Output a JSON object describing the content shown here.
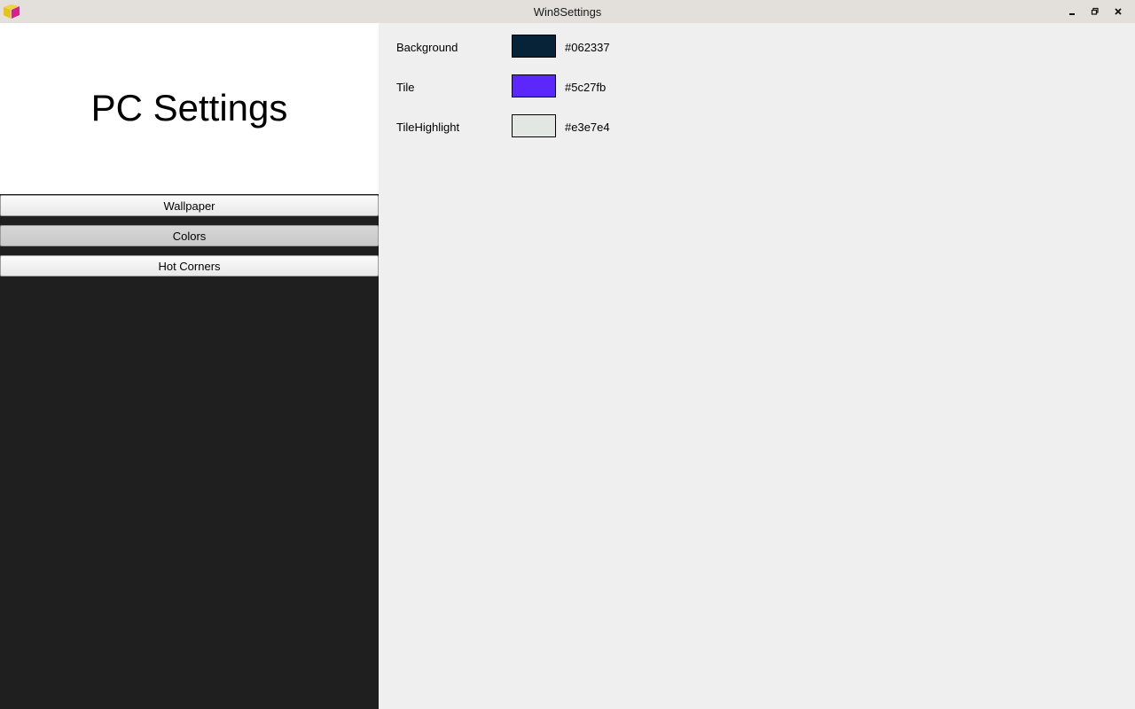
{
  "window": {
    "title": "Win8Settings",
    "controls": {
      "minimize_icon": "minimize-icon",
      "maximize_icon": "restore-icon",
      "close_icon": "close-icon"
    }
  },
  "sidebar": {
    "title": "PC Settings",
    "items": [
      {
        "label": "Wallpaper",
        "active": false
      },
      {
        "label": "Colors",
        "active": true
      },
      {
        "label": "Hot Corners",
        "active": false
      }
    ]
  },
  "colors": [
    {
      "label": "Background",
      "hex": "#062337"
    },
    {
      "label": "Tile",
      "hex": "#5c27fb"
    },
    {
      "label": "TileHighlight",
      "hex": "#e3e7e4"
    }
  ],
  "theme": {
    "sidebar_bg": "#1f1f1f",
    "header_bg": "#ffffff",
    "content_bg": "#efefef",
    "titlebar_bg": "#e3dfdb"
  }
}
